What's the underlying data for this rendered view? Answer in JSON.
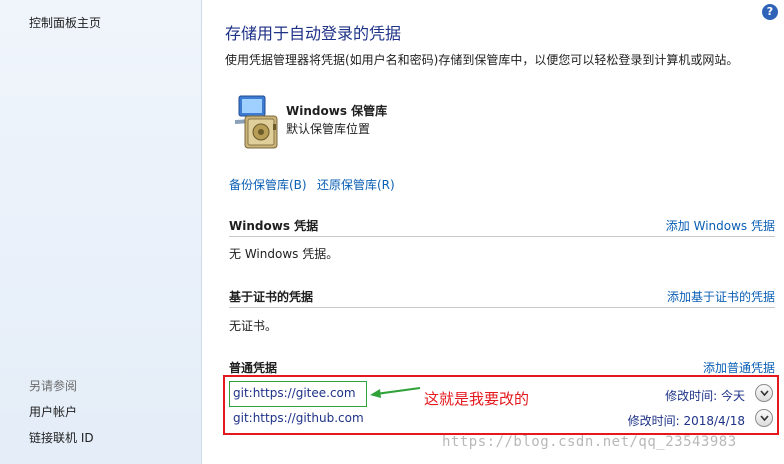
{
  "sidebar": {
    "home": "控制面板主页",
    "see_also": "另请参阅",
    "links": [
      "用户帐户",
      "链接联机 ID"
    ]
  },
  "main": {
    "title": "存储用于自动登录的凭据",
    "description": "使用凭据管理器将凭据(如用户名和密码)存储到保管库中，以便您可以轻松登录到计算机或网站。",
    "vault_name": "Windows 保管库",
    "vault_sub": "默认保管库位置",
    "backup": "备份保管库(B)",
    "restore": "还原保管库(R)"
  },
  "sections": {
    "windows": {
      "title": "Windows 凭据",
      "add": "添加 Windows 凭据",
      "empty": "无 Windows 凭据。"
    },
    "cert": {
      "title": "基于证书的凭据",
      "add": "添加基于证书的凭据",
      "empty": "无证书。"
    },
    "generic": {
      "title": "普通凭据",
      "add": "添加普通凭据",
      "items": [
        {
          "name": "git:https://gitee.com",
          "modified": "修改时间:  今天"
        },
        {
          "name": "git:https://github.com",
          "modified": "修改时间:  2018/4/18"
        }
      ]
    }
  },
  "annotation": "这就是我要改的",
  "watermark": "https://blog.csdn.net/qq_23543983",
  "colors": {
    "accent": "#0b5fb4",
    "title": "#1e3287",
    "annotation": "#e4191e",
    "highlight": "#2fa23a"
  }
}
